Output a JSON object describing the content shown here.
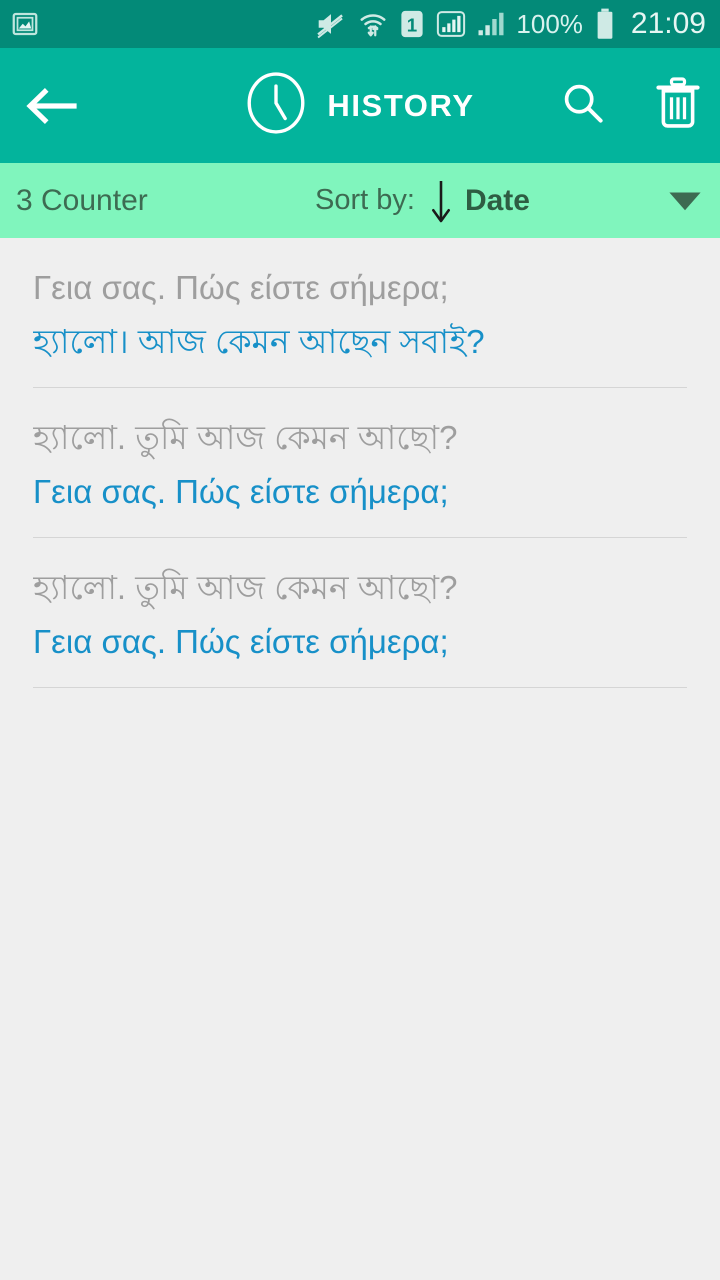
{
  "status_bar": {
    "background_color": "#038a78",
    "left_icons": [
      {
        "name": "screenshot-image-icon",
        "label": "image"
      }
    ],
    "right_icons": [
      {
        "name": "mute-icon",
        "label": "sound-muted"
      },
      {
        "name": "wifi-transfer-icon",
        "label": "wifi"
      },
      {
        "name": "sim-1-icon",
        "label": "1"
      },
      {
        "name": "signal-bars-boxed-icon",
        "label": "signal-sim1"
      },
      {
        "name": "signal-bars-icon",
        "label": "signal-sim2"
      }
    ],
    "battery_percent": "100%",
    "battery_icon": "battery-full-icon",
    "time": "21:09"
  },
  "action_bar": {
    "background_color": "#03b49c",
    "back_icon": "arrow-left-icon",
    "title_icon": "clock-icon",
    "title": "HISTORY",
    "search_icon": "search-icon",
    "delete_icon": "trash-icon"
  },
  "sort_bar": {
    "background_color": "#80f5bd",
    "counter": "3 Counter",
    "sort_by_label": "Sort by:",
    "sort_direction_icon": "arrow-down-icon",
    "sort_value": "Date",
    "dropdown_icon": "caret-down-icon"
  },
  "list": {
    "source_color": "#9e9e9e",
    "target_color": "#1790c8",
    "items": [
      {
        "source": "Γεια σας. Πώς είστε σήμερα;",
        "target": "হ্যালো। আজ কেমন আছেন সবাই?"
      },
      {
        "source": "হ্যালো. তুমি আজ কেমন আছো?",
        "target": "Γεια σας. Πώς είστε σήμερα;"
      },
      {
        "source": "হ্যালো. তুমি আজ কেমন আছো?",
        "target": "Γεια σας. Πώς είστε σήμερα;"
      }
    ]
  }
}
